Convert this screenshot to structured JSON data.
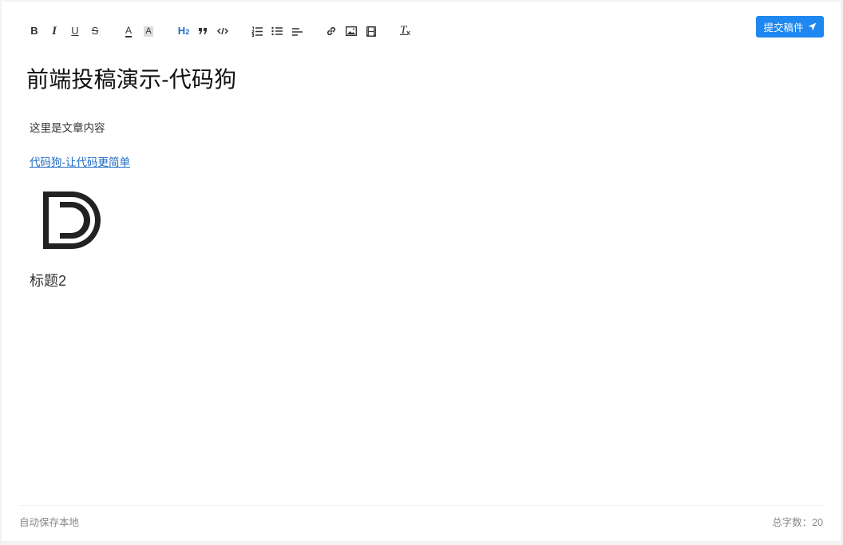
{
  "toolbar": {
    "buttons": [
      {
        "name": "bold",
        "icon": "bold-icon"
      },
      {
        "name": "italic",
        "icon": "italic-icon"
      },
      {
        "name": "underline",
        "icon": "underline-icon"
      },
      {
        "name": "strike",
        "icon": "strikethrough-icon"
      },
      {
        "name": "font-color",
        "icon": "font-color-icon"
      },
      {
        "name": "background-color",
        "icon": "background-color-icon"
      },
      {
        "name": "heading",
        "icon": "heading-icon",
        "active": true
      },
      {
        "name": "blockquote",
        "icon": "quote-icon"
      },
      {
        "name": "code",
        "icon": "code-icon"
      },
      {
        "name": "ordered-list",
        "icon": "ordered-list-icon"
      },
      {
        "name": "bullet-list",
        "icon": "bullet-list-icon"
      },
      {
        "name": "align",
        "icon": "align-left-icon"
      },
      {
        "name": "link",
        "icon": "link-icon"
      },
      {
        "name": "image",
        "icon": "image-icon"
      },
      {
        "name": "video",
        "icon": "video-icon"
      },
      {
        "name": "clear-format",
        "icon": "clear-format-icon"
      }
    ],
    "heading_label": "H",
    "heading_level": "2",
    "bold_label": "B",
    "italic_label": "I",
    "underline_label": "U",
    "strike_label": "S",
    "font_color_label": "A",
    "bg_color_label": "A",
    "clear_format_label": "T",
    "submit_label": "提交稿件",
    "submit_icon": "send-icon",
    "accent_color": "#1e87f0"
  },
  "document": {
    "title": "前端投稿演示-代码狗",
    "paragraph": "这里是文章内容",
    "link_text": "代码狗-让代码更简单",
    "logo": "daimagou-d-logo",
    "heading2": "标题2"
  },
  "footer": {
    "autosave": "自动保存本地",
    "word_count_label": "总字数：",
    "word_count": "20"
  }
}
